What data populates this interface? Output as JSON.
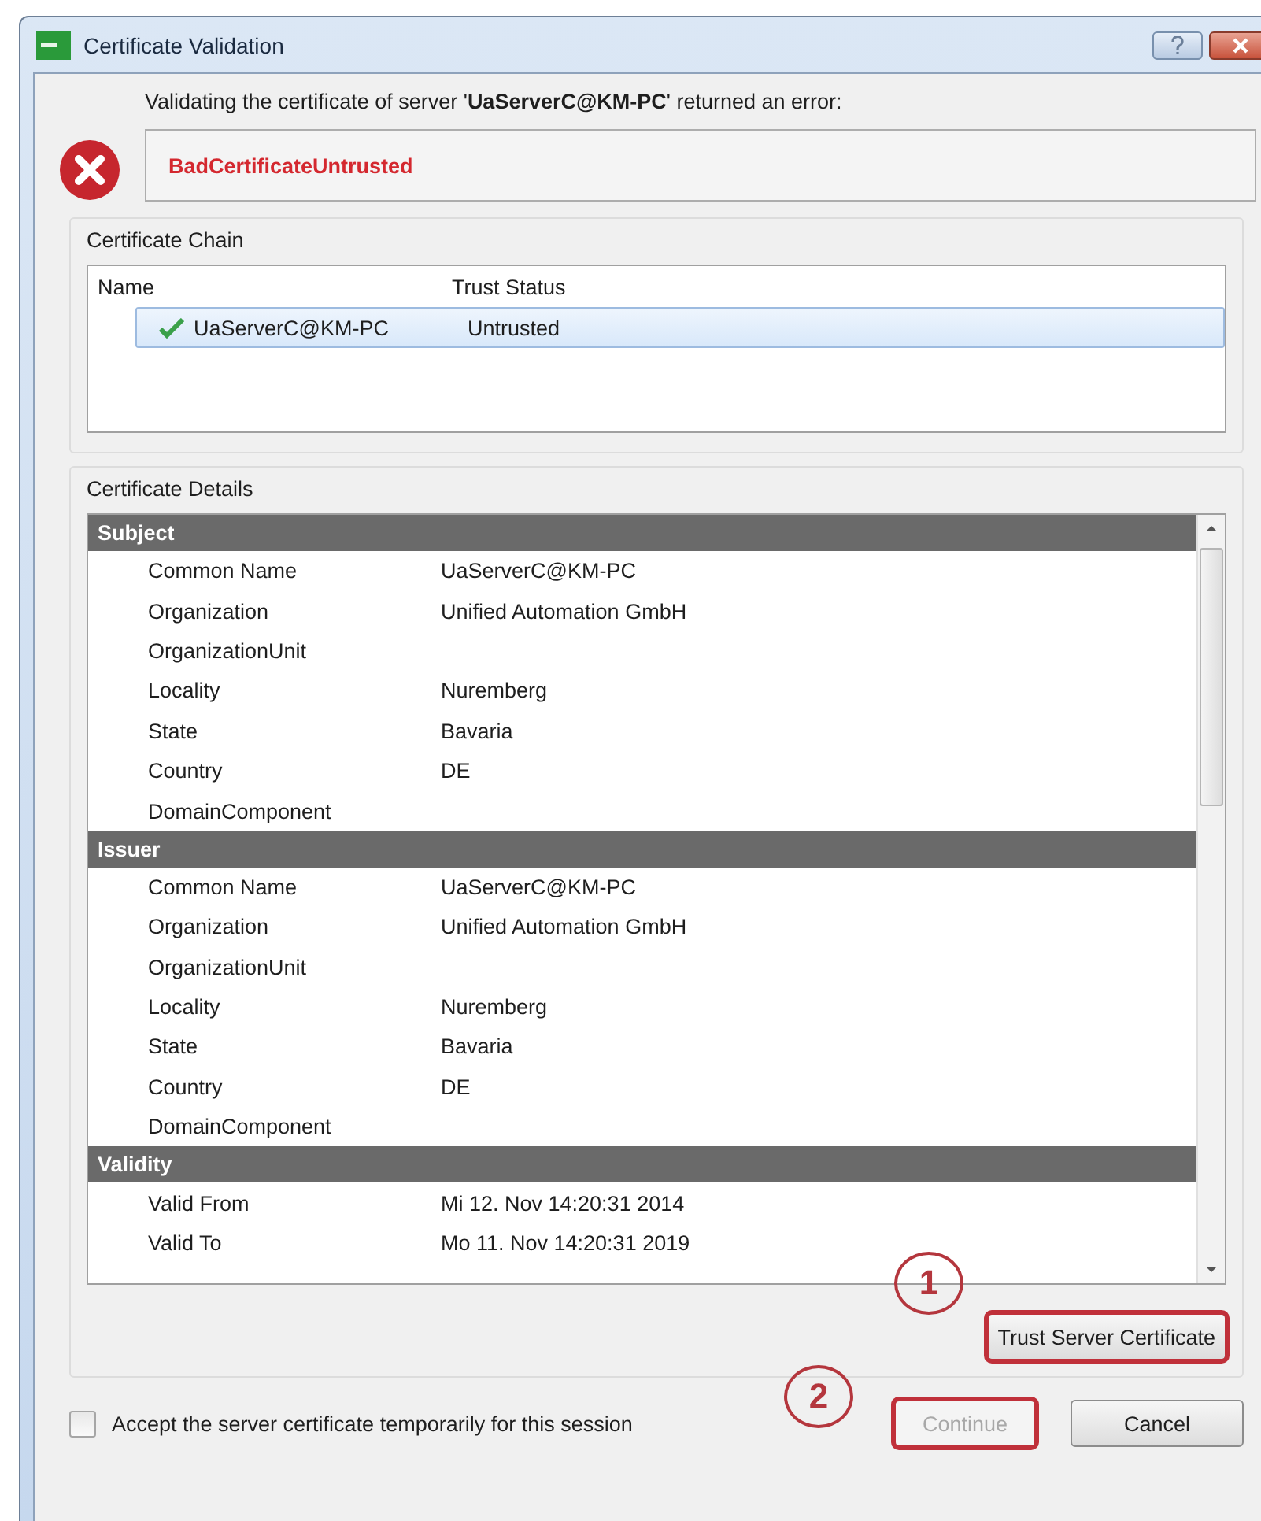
{
  "window": {
    "title": "Certificate Validation"
  },
  "message": "Validating the certificate of server '**UaServerC@KM-PC**' returned an error:",
  "error_text": "BadCertificateUntrusted",
  "chain": {
    "label": "Certificate Chain",
    "columns": [
      "Name",
      "Trust Status"
    ],
    "rows": [
      {
        "name": "UaServerC@KM-PC",
        "trust_status": "Untrusted",
        "selected": true
      }
    ]
  },
  "details": {
    "label": "Certificate Details",
    "sections": [
      {
        "title": "Subject",
        "rows": [
          {
            "field": "Common Name",
            "value": "UaServerC@KM-PC"
          },
          {
            "field": "Organization",
            "value": "Unified Automation GmbH"
          },
          {
            "field": "OrganizationUnit"
          },
          {
            "field": "Locality",
            "value": "Nuremberg"
          },
          {
            "field": "State",
            "value": "Bavaria"
          },
          {
            "field": "Country",
            "value": "DE"
          },
          {
            "field": "DomainComponent"
          }
        ]
      },
      {
        "title": "Issuer",
        "rows": [
          {
            "field": "Common Name",
            "value": "UaServerC@KM-PC"
          },
          {
            "field": "Organization",
            "value": "Unified Automation GmbH"
          },
          {
            "field": "OrganizationUnit"
          },
          {
            "field": "Locality",
            "value": "Nuremberg"
          },
          {
            "field": "State",
            "value": "Bavaria"
          },
          {
            "field": "Country",
            "value": "DE"
          },
          {
            "field": "DomainComponent"
          }
        ]
      },
      {
        "title": "Validity",
        "rows": [
          {
            "field": "Valid From",
            "value": "Mi 12. Nov 14:20:31 2014"
          },
          {
            "field": "Valid To",
            "value": "Mo 11. Nov 14:20:31 2019"
          }
        ]
      }
    ]
  },
  "trust_button": {
    "label": "Trust Server Certificate",
    "highlighted": true
  },
  "accept_checkbox": {
    "label": "Accept the server certificate temporarily for this session",
    "checked": false
  },
  "buttons": [
    {
      "label": "Continue",
      "disabled": true,
      "highlighted": true
    },
    {
      "label": "Cancel",
      "disabled": false,
      "highlighted": false
    }
  ],
  "annotations": [
    "1",
    "2"
  ]
}
